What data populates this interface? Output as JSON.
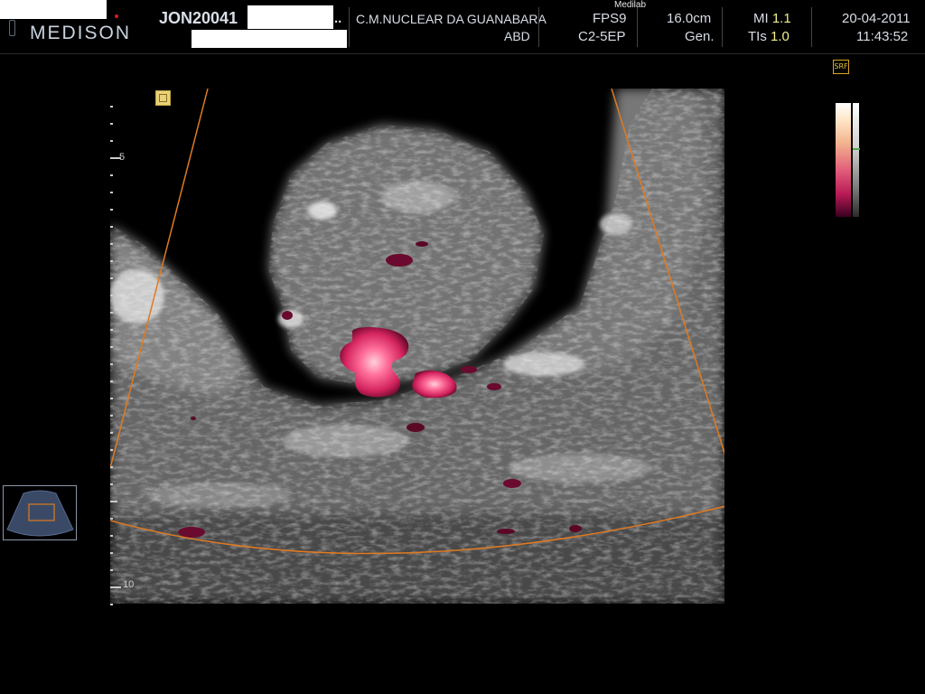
{
  "header": {
    "brand": "MEDISON",
    "patient_id": "JON20041",
    "patient_id_suffix": "..",
    "institution": "C.M.NUCLEAR DA GUANABARA",
    "application": "ABD",
    "watermark": "Medilab",
    "fps": "FPS9",
    "probe": "C2-5EP",
    "depth": "16.0cm",
    "mode": "Gen.",
    "mi_label": "MI",
    "mi_value": "1.1",
    "tis_label": "TIs",
    "tis_value": "1.0",
    "date": "20-04-2011",
    "time": "11:43:52"
  },
  "scale": {
    "top_label": "5",
    "bottom_label": "10"
  },
  "icons": {
    "srf": "SRF"
  },
  "colors": {
    "header_text": "#d8dde6",
    "value_highlight": "#f2f08a",
    "sector_outline": "#e07a20",
    "doppler_flow": "#d4245e"
  }
}
